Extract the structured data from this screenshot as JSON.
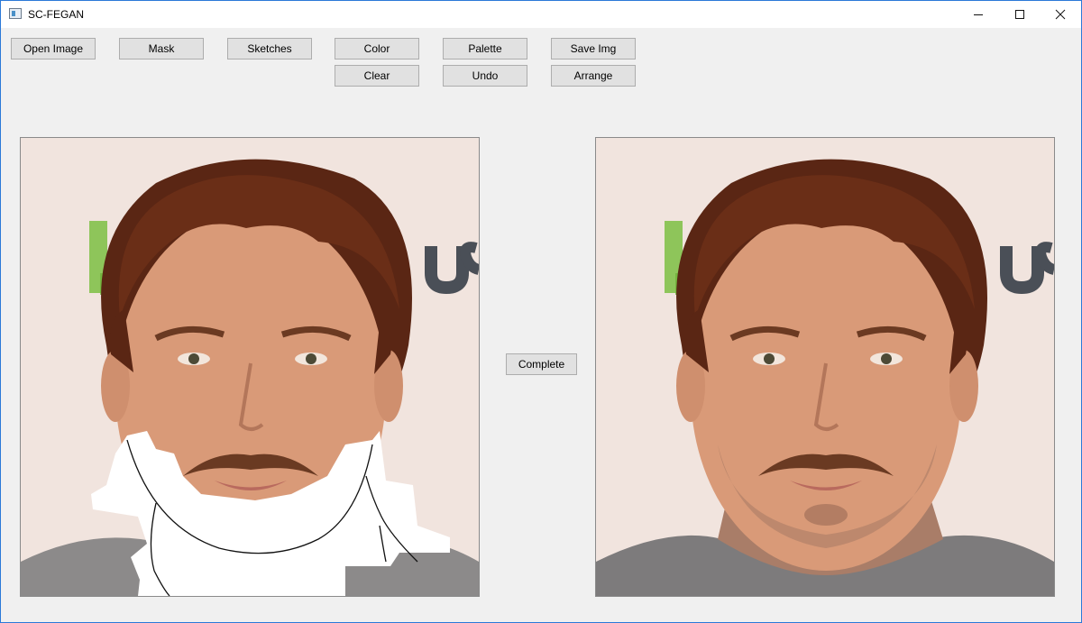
{
  "window": {
    "title": "SC-FEGAN",
    "controls": [
      "minimize",
      "maximize",
      "close"
    ]
  },
  "toolbar": {
    "open_image": "Open Image",
    "mask": "Mask",
    "sketches": "Sketches",
    "color": "Color",
    "palette": "Palette",
    "save_img": "Save Img",
    "clear": "Clear",
    "undo": "Undo",
    "arrange": "Arrange"
  },
  "complete_button": "Complete",
  "panels": {
    "input": "input-image-canvas",
    "output": "output-image-canvas"
  },
  "colors": {
    "accent_border": "#2b79d8",
    "button_face": "#e1e1e1",
    "background": "#f0f0f0"
  }
}
